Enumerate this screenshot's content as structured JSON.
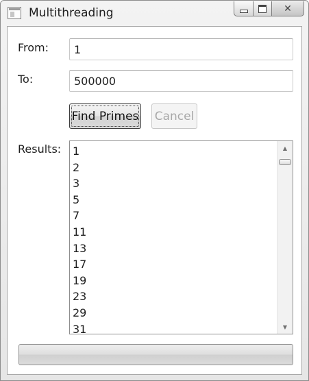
{
  "window": {
    "title": "Multithreading",
    "icon": "window-app-icon",
    "caption_buttons": [
      "minimize-icon",
      "maximize-icon",
      "close-icon"
    ]
  },
  "form": {
    "from_label": "From:",
    "from_value": "1",
    "to_label": "To:",
    "to_value": "500000",
    "find_button": "Find Primes",
    "cancel_button": "Cancel",
    "cancel_enabled": false,
    "results_label": "Results:"
  },
  "results": {
    "items": [
      "1",
      "2",
      "3",
      "5",
      "7",
      "11",
      "13",
      "17",
      "19",
      "23",
      "29",
      "31"
    ]
  },
  "progress": {
    "value": 0
  }
}
